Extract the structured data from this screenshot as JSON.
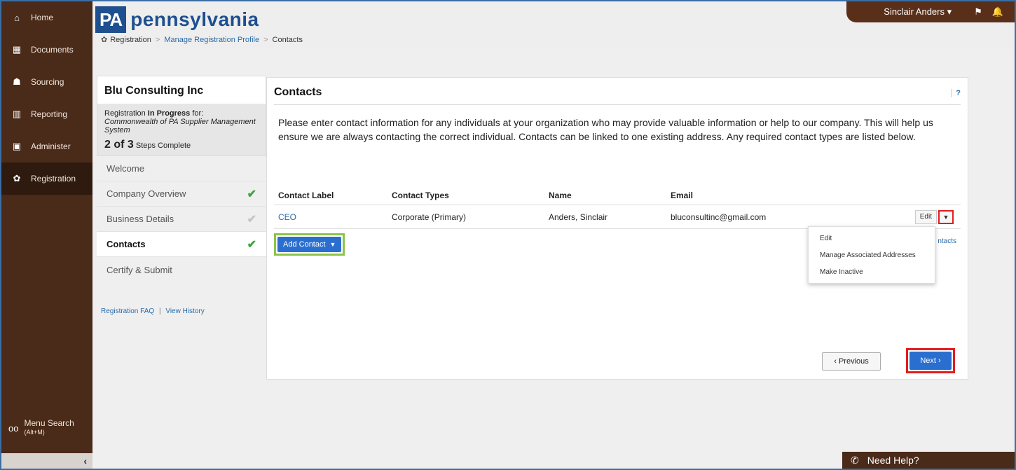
{
  "nav": {
    "items": [
      {
        "label": "Home",
        "icon": "home-icon",
        "glyph": "⌂"
      },
      {
        "label": "Documents",
        "icon": "documents-icon",
        "glyph": "▦"
      },
      {
        "label": "Sourcing",
        "icon": "sourcing-icon",
        "glyph": "☗"
      },
      {
        "label": "Reporting",
        "icon": "reporting-icon",
        "glyph": "▥"
      },
      {
        "label": "Administer",
        "icon": "administer-icon",
        "glyph": "▣"
      },
      {
        "label": "Registration",
        "icon": "gear-icon",
        "glyph": "✿"
      }
    ],
    "active_index": 5,
    "menu_search": {
      "label": "Menu Search",
      "shortcut": "(Alt+M)"
    },
    "collapse_glyph": "‹"
  },
  "header": {
    "logo_pa": "PA",
    "logo_name": "pennsylvania",
    "user_name": "Sinclair Anders",
    "user_caret": "▾",
    "flag_glyph": "⚑",
    "bell_glyph": "🔔"
  },
  "breadcrumb": {
    "root": "Registration",
    "middle": "Manage Registration Profile",
    "current": "Contacts",
    "separator": ">"
  },
  "left_panel": {
    "company": "Blu Consulting Inc",
    "status_prefix": "Registration ",
    "status_bold": "In Progress",
    "status_suffix": " for:",
    "org": "Commonwealth of PA Supplier Management System",
    "steps_bold": "2 of 3",
    "steps_text": " Steps Complete",
    "steps": [
      {
        "label": "Welcome",
        "check": ""
      },
      {
        "label": "Company Overview",
        "check": "✔"
      },
      {
        "label": "Business Details",
        "check": "✔"
      },
      {
        "label": "Contacts",
        "check": "✔"
      },
      {
        "label": "Certify & Submit",
        "check": ""
      }
    ],
    "faq_link": "Registration FAQ",
    "history_link": "View History",
    "link_sep": "|"
  },
  "main": {
    "title": "Contacts",
    "help": "?",
    "intro": "Please enter contact information for any individuals at your organization who may provide valuable information or help to our company. This will help us ensure we are always contacting the correct individual. Contacts can be linked to one existing address. Any required contact types are listed below.",
    "columns": [
      "Contact Label",
      "Contact Types",
      "Name",
      "Email"
    ],
    "rows": [
      {
        "label": "CEO",
        "types": "Corporate (Primary)",
        "name": "Anders, Sinclair",
        "email": "bluconsultinc@gmail.com"
      }
    ],
    "edit_label": "Edit",
    "caret": "▼",
    "add_contact": "Add Contact",
    "add_caret": "▼",
    "partial_link": "ntacts",
    "dropdown": [
      "Edit",
      "Manage Associated Addresses",
      "Make Inactive"
    ],
    "previous": "‹ Previous",
    "next": "Next ›"
  },
  "need_help": {
    "label": "Need Help?",
    "glyph": "✆"
  }
}
